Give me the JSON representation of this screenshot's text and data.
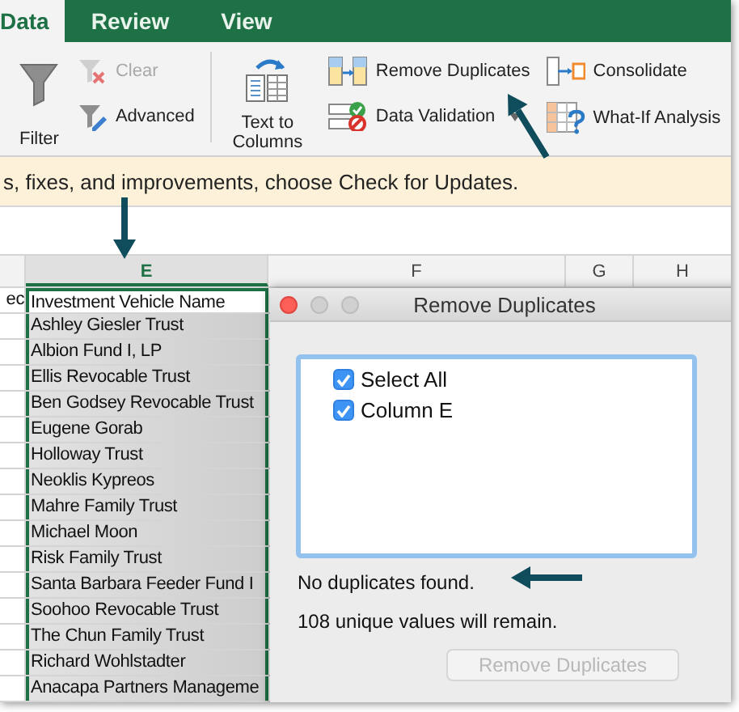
{
  "tabs": [
    {
      "label": "Data",
      "selected": true
    },
    {
      "label": "Review",
      "selected": false
    },
    {
      "label": "View",
      "selected": false
    }
  ],
  "ribbon": {
    "groups": [
      [
        {
          "label": "Filter",
          "kind": "funnel",
          "disabled": false,
          "has_menu": false
        },
        {
          "label": "Clear",
          "kind": "clear",
          "disabled": true,
          "has_menu": false
        },
        {
          "label": "Advanced",
          "kind": "advanced",
          "disabled": false,
          "has_menu": false
        }
      ],
      [
        {
          "label": "Text to Columns",
          "kind": "textcols",
          "disabled": false,
          "has_menu": false
        },
        {
          "label": "Remove Duplicates",
          "kind": "dups",
          "disabled": false,
          "has_menu": false
        },
        {
          "label": "Data Validation",
          "kind": "validation",
          "disabled": false,
          "has_menu": true
        },
        {
          "label": "Consolidate",
          "kind": "consolidate",
          "disabled": false,
          "has_menu": false
        },
        {
          "label": "What-If Analysis",
          "kind": "whatif",
          "disabled": false,
          "has_menu": false
        }
      ]
    ]
  },
  "notice": "s, fixes, and improvements, choose Check for Updates.",
  "sheet": {
    "columns": [
      {
        "label": "E",
        "selected": true
      },
      {
        "label": "F",
        "selected": false
      },
      {
        "label": "G",
        "selected": false
      },
      {
        "label": "H",
        "selected": false
      }
    ],
    "rows": [
      {
        "partial": "ec",
        "name": "Investment Vehicle Name",
        "active": true
      },
      {
        "name": "Ashley Giesler Trust",
        "active": false
      },
      {
        "name": "Albion Fund I, LP",
        "active": false
      },
      {
        "name": "Ellis Revocable Trust",
        "active": false
      },
      {
        "name": "Ben Godsey Revocable Trust",
        "active": false
      },
      {
        "name": "Eugene Gorab",
        "active": false
      },
      {
        "name": "Holloway Trust",
        "active": false
      },
      {
        "name": "Neoklis Kypreos",
        "active": false
      },
      {
        "name": "Mahre Family Trust",
        "active": false
      },
      {
        "name": "Michael Moon",
        "active": false
      },
      {
        "name": "Risk Family Trust",
        "active": false
      },
      {
        "name": "Santa Barbara Feeder Fund I",
        "active": false
      },
      {
        "name": "Soohoo Revocable Trust",
        "active": false
      },
      {
        "name": "The Chun Family Trust",
        "active": false
      },
      {
        "name": "Richard Wohlstadter",
        "active": false
      },
      {
        "name": "Anacapa Partners Manageme",
        "active": false
      }
    ]
  },
  "dialog": {
    "title": "Remove Duplicates",
    "items": [
      {
        "label": "Select All",
        "checked": true
      },
      {
        "label": "Column E",
        "checked": true
      }
    ],
    "message": "No duplicates found.",
    "summary": "108 unique values will remain.",
    "button": {
      "label": "Remove Duplicates",
      "disabled": true
    }
  }
}
